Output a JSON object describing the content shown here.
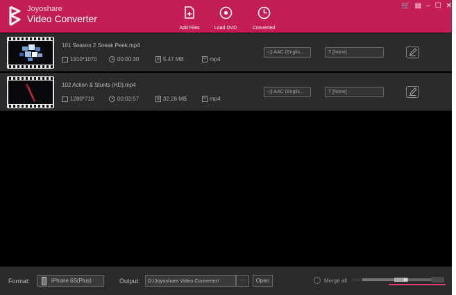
{
  "app": {
    "name_line1": "Joyoshare",
    "name_line2": "Video Converter"
  },
  "toolbar": {
    "add_files": "Add Files",
    "load_dvd": "Load DVD",
    "converted": "Converted"
  },
  "window_controls": {
    "cart": "🛒",
    "menu": "▤",
    "minimize": "–",
    "maximize": "☐",
    "close": "✕"
  },
  "files": [
    {
      "name": "101 Season 2 Sneak Peek.mp4",
      "resolution": "1910*1070",
      "duration": "00:00:30",
      "size": "5.47 MB",
      "format": "mp4",
      "audio": "AAC (Englis...",
      "subtitle": "[None]"
    },
    {
      "name": "102 Action & Stunts (HD).mp4",
      "resolution": "1280*718",
      "duration": "00:02:57",
      "size": "32.28 MB",
      "format": "mp4",
      "audio": "AAC (Englis...",
      "subtitle": "[None]"
    }
  ],
  "bottom": {
    "format_label": "Format:",
    "format_value": "iPhone 6S(Plus)",
    "output_label": "Output:",
    "output_path": "D:/Joyoshare Video Converter/",
    "browse_label": "···",
    "open_label": "Open",
    "merge_label": "Merge all"
  },
  "colors": {
    "brand": "#c51e54",
    "row_bg": "#2b2b2b",
    "panel_bg": "#000000"
  }
}
